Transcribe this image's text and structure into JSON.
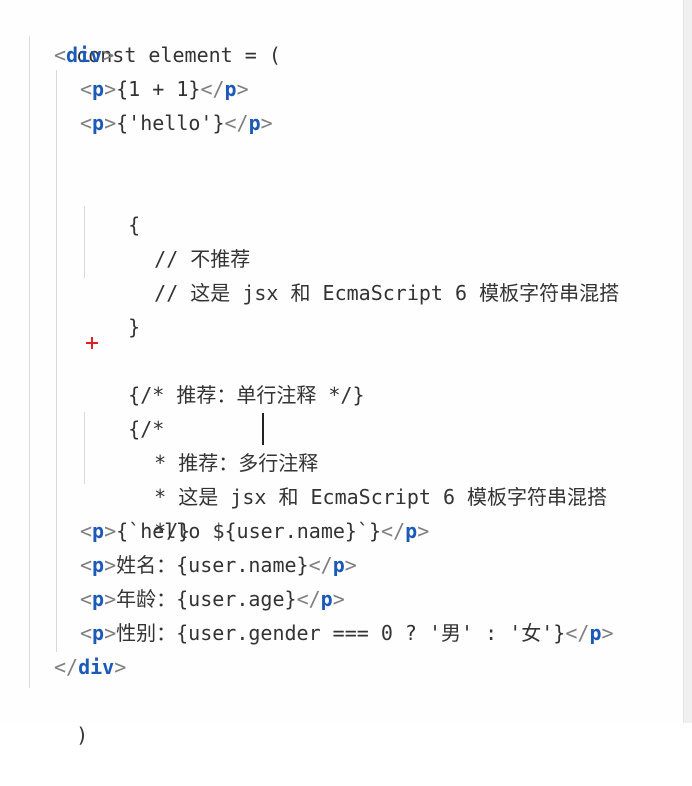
{
  "code": {
    "line1": "const element = (",
    "line2_tag": "div",
    "line3_expr": "{1 + 1}",
    "line4_expr": "{'hello'}",
    "line6_open": "{",
    "line7_comment": "// 不推荐",
    "line8_comment": "// 这是 jsx 和 EcmaScript 6 模板字符串混搭",
    "line9_close": "}",
    "line11_comment": "{/* 推荐：单行注释 */}",
    "line12_open": "{/*",
    "line13_comment": "* 推荐：多行注释",
    "line14_comment": "* 这是 jsx 和 EcmaScript 6 模板字符串混搭",
    "line15_close": "*/}",
    "line16_expr": "{`hello ${user.name}`}",
    "line17_expr": "姓名：{user.name}",
    "line18_expr": "年龄：{user.age}",
    "line19_expr": "性别：{user.gender === 0 ? '男' : '女'}",
    "line20_tag": "div",
    "line21": ")",
    "p_tag": "p",
    "lt": "<",
    "gt": ">",
    "lt_slash": "</"
  }
}
